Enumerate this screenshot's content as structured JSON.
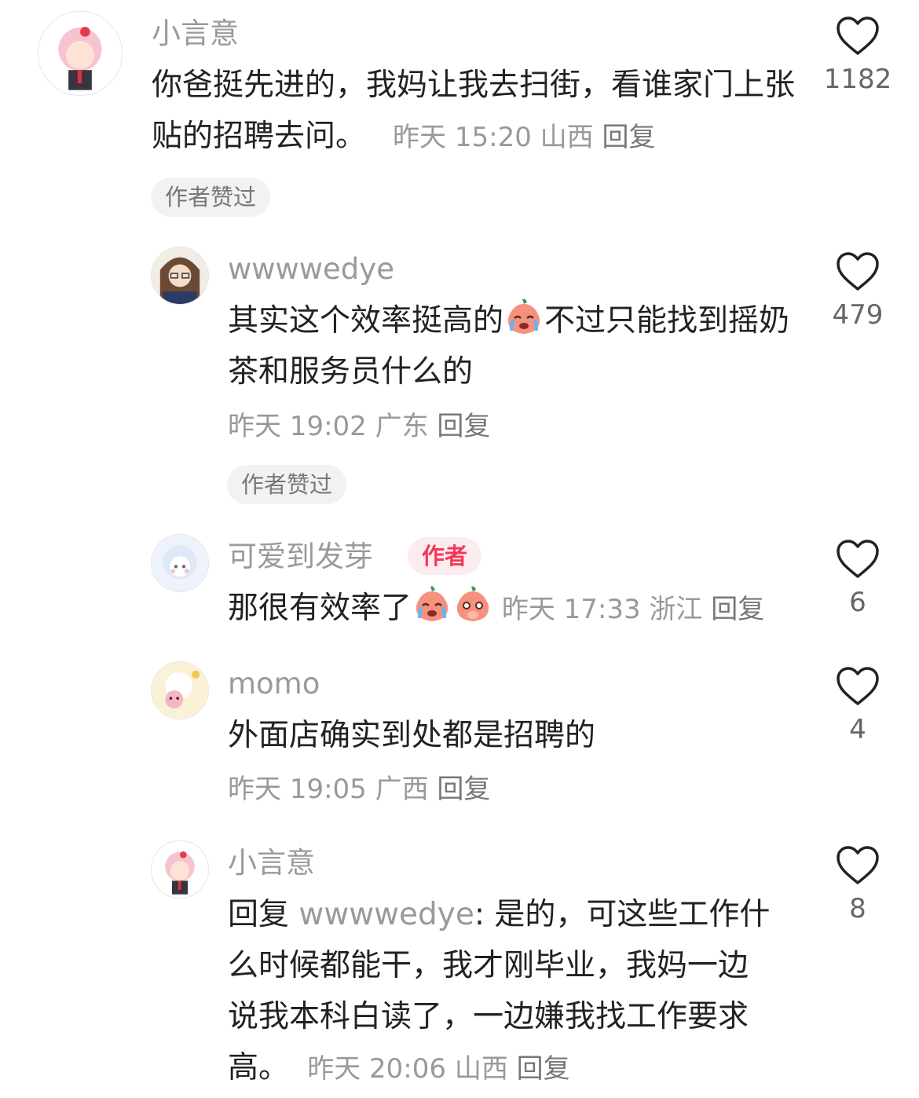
{
  "comments": [
    {
      "username": "小言意",
      "text": "你爸挺先进的，我妈让我去扫街，看谁家门上张贴的招聘去问。",
      "time": "昨天 15:20",
      "location": "山西",
      "reply_label": "回复",
      "likes": "1182",
      "liked_badge": "作者赞过"
    },
    {
      "username": "wwwwedye",
      "text_before": "其实这个效率挺高的",
      "emoji": "crying-peach-emoji",
      "text_after": "不过只能找到摇奶茶和服务员什么的",
      "time": "昨天 19:02",
      "location": "广东",
      "reply_label": "回复",
      "likes": "479",
      "liked_badge": "作者赞过"
    },
    {
      "username": "可爱到发芽",
      "author_badge": "作者",
      "text": "那很有效率了",
      "emojis": [
        "crying-peach-emoji",
        "shy-peach-emoji"
      ],
      "time": "昨天 17:33",
      "location": "浙江",
      "reply_label": "回复",
      "likes": "6"
    },
    {
      "username": "momo",
      "text": "外面店确实到处都是招聘的",
      "time": "昨天 19:05",
      "location": "广西",
      "reply_label": "回复",
      "likes": "4"
    },
    {
      "username": "小言意",
      "reply_prefix": "回复",
      "reply_to": "wwwwedye",
      "text": "是的，可这些工作什么时候都能干，我才刚毕业，我妈一边说我本科白读了，一边嫌我找工作要求高。",
      "time": "昨天 20:06",
      "location": "山西",
      "reply_label": "回复",
      "likes": "8"
    }
  ],
  "colors": {
    "muted": "#999999",
    "author_badge_bg": "#fdecef",
    "author_badge_text": "#f2385a",
    "liked_badge_bg": "#f2f2f2"
  }
}
